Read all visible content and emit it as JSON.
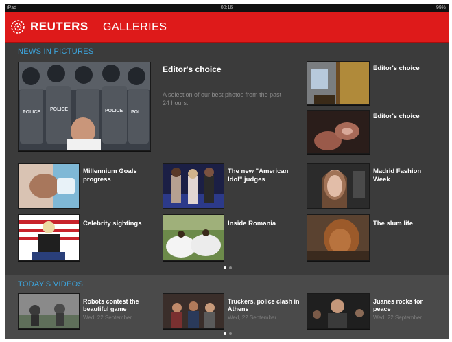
{
  "status_bar": {
    "device": "iPad",
    "time": "00:16",
    "battery": "99%"
  },
  "header": {
    "brand": "REUTERS",
    "section": "GALLERIES",
    "logo_icon": "reuters-logo-icon",
    "bg_color": "#de1a1a"
  },
  "news": {
    "label": "NEWS IN PICTURES",
    "hero": {
      "title": "Editor's choice",
      "description": "A selection of our best photos from the past 24 hours."
    },
    "side": [
      {
        "title": "Editor's choice"
      },
      {
        "title": "Editor's choice"
      }
    ],
    "grid": [
      {
        "title": "Millennium Goals progress"
      },
      {
        "title": "The new \"American Idol\" judges"
      },
      {
        "title": "Madrid Fashion Week"
      },
      {
        "title": "Celebrity sightings"
      },
      {
        "title": "Inside Romania"
      },
      {
        "title": "The slum life"
      }
    ]
  },
  "videos": {
    "label": "TODAY'S VIDEOS",
    "items": [
      {
        "title": "Robots contest the beautiful game",
        "date": "Wed, 22 September"
      },
      {
        "title": "Truckers, police clash in Athens",
        "date": "Wed, 22 September"
      },
      {
        "title": "Juanes rocks for peace",
        "date": "Wed, 22 September"
      }
    ]
  },
  "colors": {
    "accent": "#3ca4dc",
    "background": "#3b3b3b"
  }
}
